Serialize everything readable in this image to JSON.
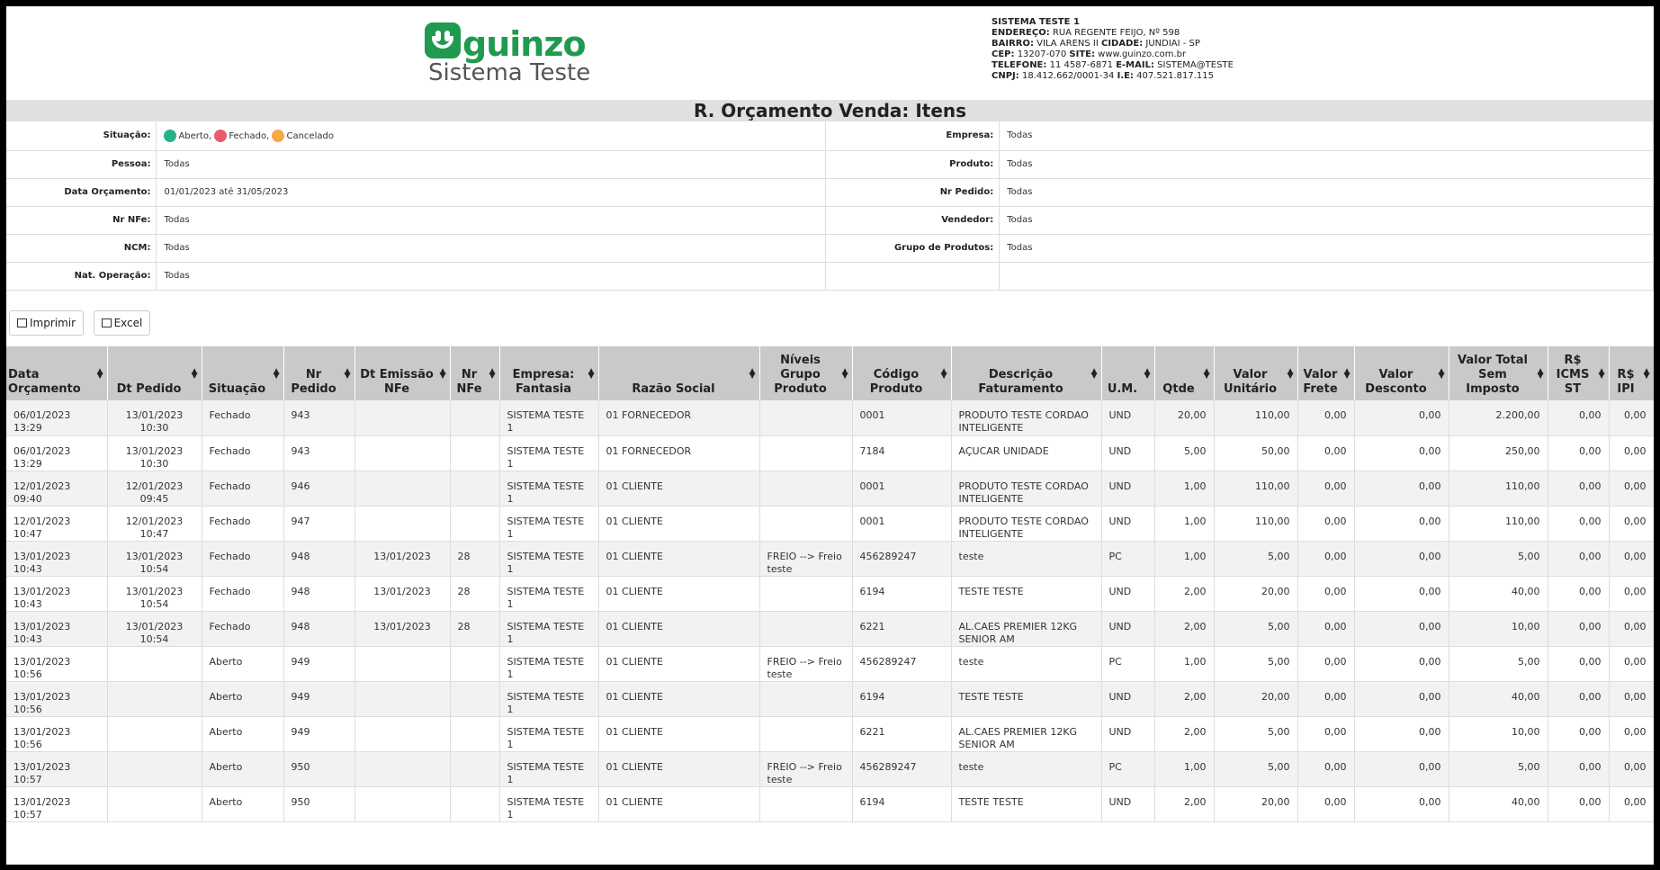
{
  "logo": {
    "brand": "guinzo",
    "subtitle": "Sistema Teste"
  },
  "company": {
    "name": "SISTEMA TESTE 1",
    "address_label": "ENDEREÇO:",
    "address": "RUA REGENTE FEIJO, Nº 598",
    "bairro_label": "BAIRRO:",
    "bairro": "VILA ARENS II",
    "cidade_label": "CIDADE:",
    "cidade": "JUNDIAI - SP",
    "cep_label": "CEP:",
    "cep": "13207-070",
    "site_label": "SITE:",
    "site": "www.guinzo.com.br",
    "telefone_label": "TELEFONE:",
    "telefone": "11 4587-6871",
    "email_label": "E-MAIL:",
    "email": "SISTEMA@TESTE",
    "cnpj_label": "CNPJ:",
    "cnpj": "18.412.662/0001-34",
    "ie_label": "I.E:",
    "ie": "407.521.817.115"
  },
  "page_title": "R. Orçamento Venda: Itens",
  "filters": {
    "situacao_label": "Situação:",
    "situacao": [
      {
        "label": "Aberto,",
        "color": "#26b38a"
      },
      {
        "label": "Fechado,",
        "color": "#ec5a6e"
      },
      {
        "label": "Cancelado",
        "color": "#f6a94a"
      }
    ],
    "empresa_label": "Empresa:",
    "empresa": "Todas",
    "pessoa_label": "Pessoa:",
    "pessoa": "Todas",
    "produto_label": "Produto:",
    "produto": "Todas",
    "data_label": "Data Orçamento:",
    "data": "01/01/2023 até 31/05/2023",
    "nrpedido_label": "Nr Pedido:",
    "nrpedido": "Todas",
    "nrnfe_label": "Nr NFe:",
    "nrnfe": "Todas",
    "vendedor_label": "Vendedor:",
    "vendedor": "Todas",
    "ncm_label": "NCM:",
    "ncm": "Todas",
    "grupo_label": "Grupo de Produtos:",
    "grupo": "Todas",
    "natop_label": "Nat. Operação:",
    "natop": "Todas"
  },
  "toolbar": {
    "print_label": "Imprimir",
    "excel_label": "Excel"
  },
  "table": {
    "headers": [
      "Data Orçamento",
      "Dt Pedido",
      "Situação",
      "Nr Pedido",
      "Dt Emissão NFe",
      "Nr NFe",
      "Empresa: Fantasia",
      "Razão Social",
      "Níveis Grupo Produto",
      "Código Produto",
      "Descrição Faturamento",
      "U.M.",
      "Qtde",
      "Valor Unitário",
      "Valor Frete",
      "Valor Desconto",
      "Valor Total Sem Imposto",
      "R$ ICMS ST",
      "R$ IPI"
    ],
    "rows": [
      [
        "06/01/2023 13:29",
        "13/01/2023 10:30",
        "Fechado",
        "943",
        "",
        "",
        "SISTEMA TESTE 1",
        "01 FORNECEDOR",
        "",
        "0001",
        "PRODUTO TESTE CORDAO INTELIGENTE",
        "UND",
        "20,00",
        "110,00",
        "0,00",
        "0,00",
        "2.200,00",
        "0,00",
        "0,00"
      ],
      [
        "06/01/2023 13:29",
        "13/01/2023 10:30",
        "Fechado",
        "943",
        "",
        "",
        "SISTEMA TESTE 1",
        "01 FORNECEDOR",
        "",
        "7184",
        "AÇUCAR UNIDADE",
        "UND",
        "5,00",
        "50,00",
        "0,00",
        "0,00",
        "250,00",
        "0,00",
        "0,00"
      ],
      [
        "12/01/2023 09:40",
        "12/01/2023 09:45",
        "Fechado",
        "946",
        "",
        "",
        "SISTEMA TESTE 1",
        "01 CLIENTE",
        "",
        "0001",
        "PRODUTO TESTE CORDAO INTELIGENTE",
        "UND",
        "1,00",
        "110,00",
        "0,00",
        "0,00",
        "110,00",
        "0,00",
        "0,00"
      ],
      [
        "12/01/2023 10:47",
        "12/01/2023 10:47",
        "Fechado",
        "947",
        "",
        "",
        "SISTEMA TESTE 1",
        "01 CLIENTE",
        "",
        "0001",
        "PRODUTO TESTE CORDAO INTELIGENTE",
        "UND",
        "1,00",
        "110,00",
        "0,00",
        "0,00",
        "110,00",
        "0,00",
        "0,00"
      ],
      [
        "13/01/2023 10:43",
        "13/01/2023 10:54",
        "Fechado",
        "948",
        "13/01/2023",
        "28",
        "SISTEMA TESTE 1",
        "01 CLIENTE",
        "FREIO --> Freio teste",
        "456289247",
        "teste",
        "PC",
        "1,00",
        "5,00",
        "0,00",
        "0,00",
        "5,00",
        "0,00",
        "0,00"
      ],
      [
        "13/01/2023 10:43",
        "13/01/2023 10:54",
        "Fechado",
        "948",
        "13/01/2023",
        "28",
        "SISTEMA TESTE 1",
        "01 CLIENTE",
        "",
        "6194",
        "TESTE TESTE",
        "UND",
        "2,00",
        "20,00",
        "0,00",
        "0,00",
        "40,00",
        "0,00",
        "0,00"
      ],
      [
        "13/01/2023 10:43",
        "13/01/2023 10:54",
        "Fechado",
        "948",
        "13/01/2023",
        "28",
        "SISTEMA TESTE 1",
        "01 CLIENTE",
        "",
        "6221",
        "AL.CAES PREMIER 12KG SENIOR AM",
        "UND",
        "2,00",
        "5,00",
        "0,00",
        "0,00",
        "10,00",
        "0,00",
        "0,00"
      ],
      [
        "13/01/2023 10:56",
        "",
        "Aberto",
        "949",
        "",
        "",
        "SISTEMA TESTE 1",
        "01 CLIENTE",
        "FREIO --> Freio teste",
        "456289247",
        "teste",
        "PC",
        "1,00",
        "5,00",
        "0,00",
        "0,00",
        "5,00",
        "0,00",
        "0,00"
      ],
      [
        "13/01/2023 10:56",
        "",
        "Aberto",
        "949",
        "",
        "",
        "SISTEMA TESTE 1",
        "01 CLIENTE",
        "",
        "6194",
        "TESTE TESTE",
        "UND",
        "2,00",
        "20,00",
        "0,00",
        "0,00",
        "40,00",
        "0,00",
        "0,00"
      ],
      [
        "13/01/2023 10:56",
        "",
        "Aberto",
        "949",
        "",
        "",
        "SISTEMA TESTE 1",
        "01 CLIENTE",
        "",
        "6221",
        "AL.CAES PREMIER 12KG SENIOR AM",
        "UND",
        "2,00",
        "5,00",
        "0,00",
        "0,00",
        "10,00",
        "0,00",
        "0,00"
      ],
      [
        "13/01/2023 10:57",
        "",
        "Aberto",
        "950",
        "",
        "",
        "SISTEMA TESTE 1",
        "01 CLIENTE",
        "FREIO --> Freio teste",
        "456289247",
        "teste",
        "PC",
        "1,00",
        "5,00",
        "0,00",
        "0,00",
        "5,00",
        "0,00",
        "0,00"
      ],
      [
        "13/01/2023 10:57",
        "",
        "Aberto",
        "950",
        "",
        "",
        "SISTEMA TESTE 1",
        "01 CLIENTE",
        "",
        "6194",
        "TESTE TESTE",
        "UND",
        "2,00",
        "20,00",
        "0,00",
        "0,00",
        "40,00",
        "0,00",
        "0,00"
      ]
    ]
  }
}
